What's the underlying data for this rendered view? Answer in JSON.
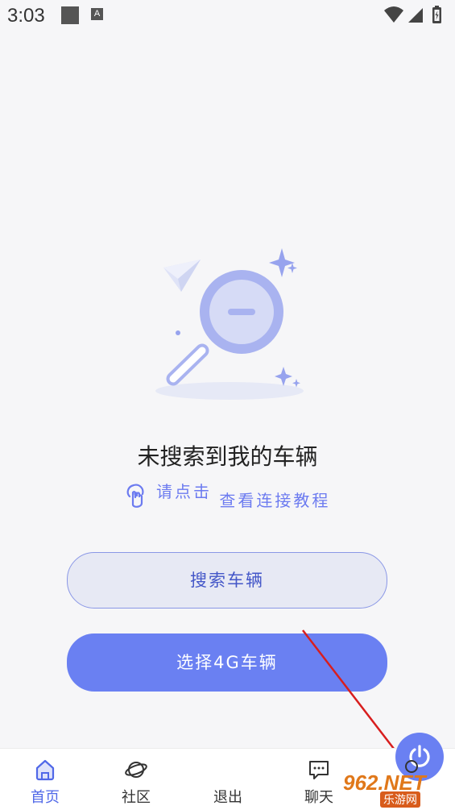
{
  "status_bar": {
    "time": "3:03",
    "a_badge": "A"
  },
  "empty_state": {
    "title": "未搜索到我的车辆",
    "hint_part1": "请点击",
    "hint_part2": "查看连接教程"
  },
  "buttons": {
    "search_vehicle": "搜索车辆",
    "select_4g_vehicle": "选择4G车辆"
  },
  "tab_bar": {
    "home": "首页",
    "community": "社区",
    "exit": "退出",
    "chat": "聊天"
  },
  "watermark": {
    "main": "962.NET",
    "sub": "乐游网"
  },
  "colors": {
    "accent": "#6a80f2",
    "accent_dark": "#5068e8",
    "button_light": "#e7e9f4"
  },
  "icons": [
    "square-icon",
    "a-badge-icon",
    "wifi-icon",
    "signal-icon",
    "battery-icon",
    "hand-pointer-icon",
    "home-icon",
    "planet-icon",
    "power-icon",
    "chat-icon",
    "me-icon"
  ]
}
